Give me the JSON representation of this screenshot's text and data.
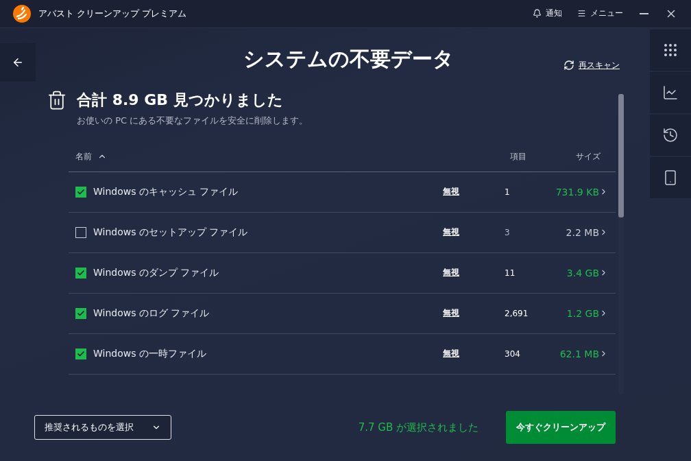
{
  "window": {
    "title": "アバスト クリーンアップ プレミアム",
    "notify": "通知",
    "menu": "メニュー"
  },
  "page": {
    "title": "システムの不要データ",
    "rescan": "再スキャン"
  },
  "summary": {
    "headline": "合計 8.9 GB 見つかりました",
    "description": "お使いの PC にある不要なファイルを安全に削除します。"
  },
  "table": {
    "columns": [
      "名前",
      "項目",
      "サイズ"
    ],
    "rows": [
      {
        "name": "Windows のキャッシュ ファイル",
        "ignore": "無視",
        "count": "1",
        "size": "731.9 KB",
        "checked": true
      },
      {
        "name": "Windows のセットアップ ファイル",
        "ignore": "無視",
        "count": "3",
        "size": "2.2 MB",
        "checked": false
      },
      {
        "name": "Windows のダンプ ファイル",
        "ignore": "無視",
        "count": "11",
        "size": "3.4 GB",
        "checked": true
      },
      {
        "name": "Windows のログ ファイル",
        "ignore": "無視",
        "count": "2,691",
        "size": "1.2 GB",
        "checked": true
      },
      {
        "name": "Windows の一時ファイル",
        "ignore": "無視",
        "count": "304",
        "size": "62.1 MB",
        "checked": true
      }
    ]
  },
  "footer": {
    "select": "推奨されるものを選択",
    "selected_total": "7.7 GB が選択されました",
    "clean_button": "今すぐクリーンアップ"
  }
}
